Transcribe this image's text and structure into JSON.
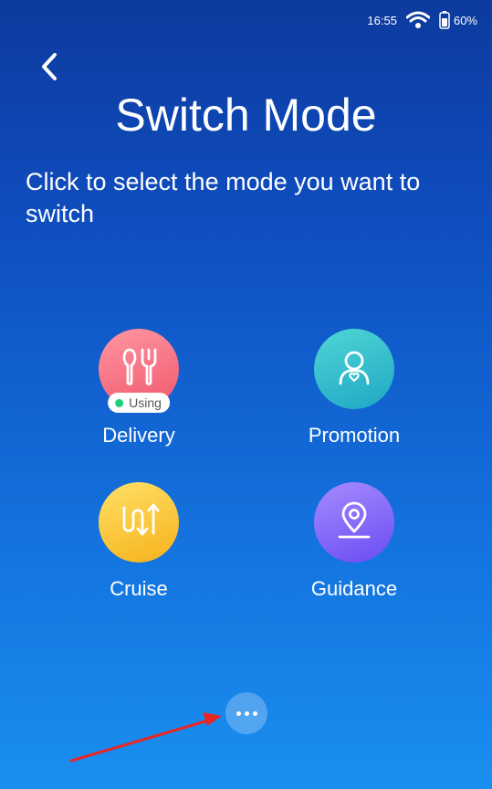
{
  "status_bar": {
    "time": "16:55",
    "battery": "60%",
    "wifi_icon": "wifi-icon",
    "battery_icon": "battery-icon"
  },
  "header": {
    "back_icon": "chevron-left-icon",
    "title": "Switch Mode",
    "subtitle": "Click to select the mode you want to switch"
  },
  "modes": [
    {
      "label": "Delivery",
      "icon": "fork-spoon-icon",
      "badge": "Using",
      "color": "#f0586d"
    },
    {
      "label": "Promotion",
      "icon": "person-heart-icon",
      "color": "#1fa7c4"
    },
    {
      "label": "Cruise",
      "icon": "route-loop-icon",
      "color": "#f6b21c"
    },
    {
      "label": "Guidance",
      "icon": "location-pin-icon",
      "color": "#6a4cf3"
    }
  ],
  "footer": {
    "more_icon": "more-dots-icon"
  },
  "colors": {
    "background_top": "#0d3a9e",
    "background_bottom": "#1a8ff0",
    "using_dot": "#1fd07a",
    "annotation_arrow": "#e82626"
  }
}
